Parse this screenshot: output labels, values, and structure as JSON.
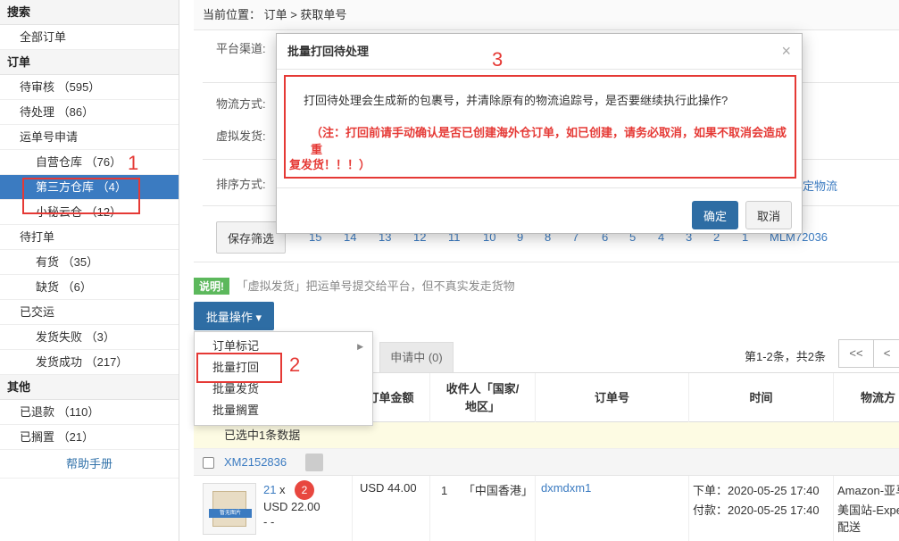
{
  "sidebar": {
    "search_section": "搜索",
    "all_orders": "全部订单",
    "orders_section": "订单",
    "pending_review": "待审核 （595）",
    "to_process": "待处理 （86）",
    "waybill_apply": "运单号申请",
    "own_warehouse": "自营仓库 （76）",
    "third_party_warehouse": "第三方仓库 （4）",
    "xiaomi_cloud": "小秘云仓 （12）",
    "to_print": "待打单",
    "in_stock": "有货 （35）",
    "out_of_stock": "缺货 （6）",
    "shipped": "已交运",
    "ship_failed": "发货失败 （3）",
    "ship_success": "发货成功 （217）",
    "other_section": "其他",
    "refunded": "已退款 （110）",
    "shelved": "已搁置 （21）",
    "help": "帮助手册"
  },
  "breadcrumb": "当前位置： 订单 > 获取单号",
  "filters": {
    "platform_label": "平台渠道:",
    "logistics_label": "物流方式:",
    "virtual_ship_label": "虚拟发货:",
    "sort_label": "排序方式:",
    "sort_link_tail": "定物流",
    "save_filter": "保存筛选",
    "numbers": [
      "15",
      "14",
      "13",
      "12",
      "11",
      "10",
      "9",
      "8",
      "7",
      "6",
      "5",
      "4",
      "3",
      "2",
      "1",
      "MLM72036"
    ]
  },
  "note": {
    "badge": "说明!",
    "text": "「虚拟发货」把运单号提交给平台，但不真实发走货物"
  },
  "batch": {
    "button": "批量操作 ▾",
    "items": {
      "order_mark": "订单标记",
      "batch_reprint": "批量打回",
      "batch_ship": "批量发货",
      "batch_shelve": "批量搁置"
    }
  },
  "tabs": {
    "applying": "申请中 (0)"
  },
  "pager": {
    "summary": "第1-2条，共2条",
    "first": "<<",
    "prev": "<"
  },
  "table": {
    "headers": {
      "amount": "订单金额",
      "recipient": "收件人「国家/地区」",
      "order_no": "订单号",
      "time": "时间",
      "logistics": "物流方"
    },
    "selected_note": "已选中1条数据",
    "group_order": "XM2152836",
    "row": {
      "qty": "21",
      "qty_x": "x",
      "unit_price": "USD 22.00",
      "dash": "- -",
      "img_label": "暂无图片",
      "amount": "USD 44.00",
      "recipient_num": "1",
      "recipient_region": "「中国香港」",
      "order_id": "dxmdxm1",
      "order_time": "下单：2020-05-25 17:40",
      "pay_time": "付款：2020-05-25 17:40",
      "logistics_1": "Amazon-亚马",
      "logistics_2": "美国站-Expe",
      "logistics_3": "配送"
    }
  },
  "modal": {
    "title": "批量打回待处理",
    "close": "×",
    "message": "打回待处理会生成新的包裹号，并清除原有的物流追踪号，是否要继续执行此操作?",
    "warning_1": "（注：打回前请手动确认是否已创建海外仓订单，如已创建，请务必取消，如果不取消会造成重",
    "warning_2": "复发货！！！）",
    "ok": "确定",
    "cancel": "取消"
  },
  "annotations": {
    "n1": "1",
    "n2": "2",
    "n3": "3",
    "badge2": "2"
  },
  "colors": {
    "primary": "#2e6da4",
    "active": "#3b7bc1",
    "annotation": "#e53935"
  }
}
